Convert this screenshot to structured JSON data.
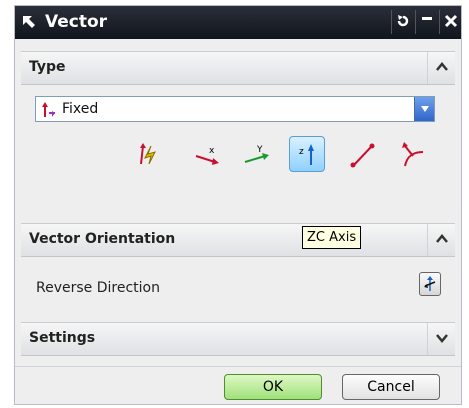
{
  "window": {
    "title": "Vector",
    "title_icon": "vector-arrow-icon",
    "buttons": [
      "reset-icon",
      "minimize-icon",
      "close-icon"
    ]
  },
  "type_section": {
    "title": "Type",
    "dropdown": {
      "value": "Fixed",
      "icon": "fixed-vector-icon"
    },
    "vector_buttons": [
      {
        "name": "inferred-vector",
        "icon": "lightning-vector-icon",
        "active": false
      },
      {
        "name": "xc-axis",
        "icon": "xc-axis-icon",
        "label": "X",
        "active": false
      },
      {
        "name": "yc-axis",
        "icon": "yc-axis-icon",
        "label": "Y",
        "active": false
      },
      {
        "name": "zc-axis",
        "icon": "zc-axis-icon",
        "label": "Z",
        "active": true
      },
      {
        "name": "two-points",
        "icon": "two-points-icon",
        "active": false
      },
      {
        "name": "curve-vector",
        "icon": "curve-vector-icon",
        "active": false
      }
    ]
  },
  "tooltip": "ZC Axis",
  "orientation_section": {
    "title": "Vector Orientation",
    "reverse_label": "Reverse Direction"
  },
  "settings_section": {
    "title": "Settings"
  },
  "footer": {
    "ok": "OK",
    "cancel": "Cancel"
  },
  "colors": {
    "titlebar": "#151922",
    "ok_green": "#9fe27a",
    "active_blue": "#8fd1ff"
  }
}
